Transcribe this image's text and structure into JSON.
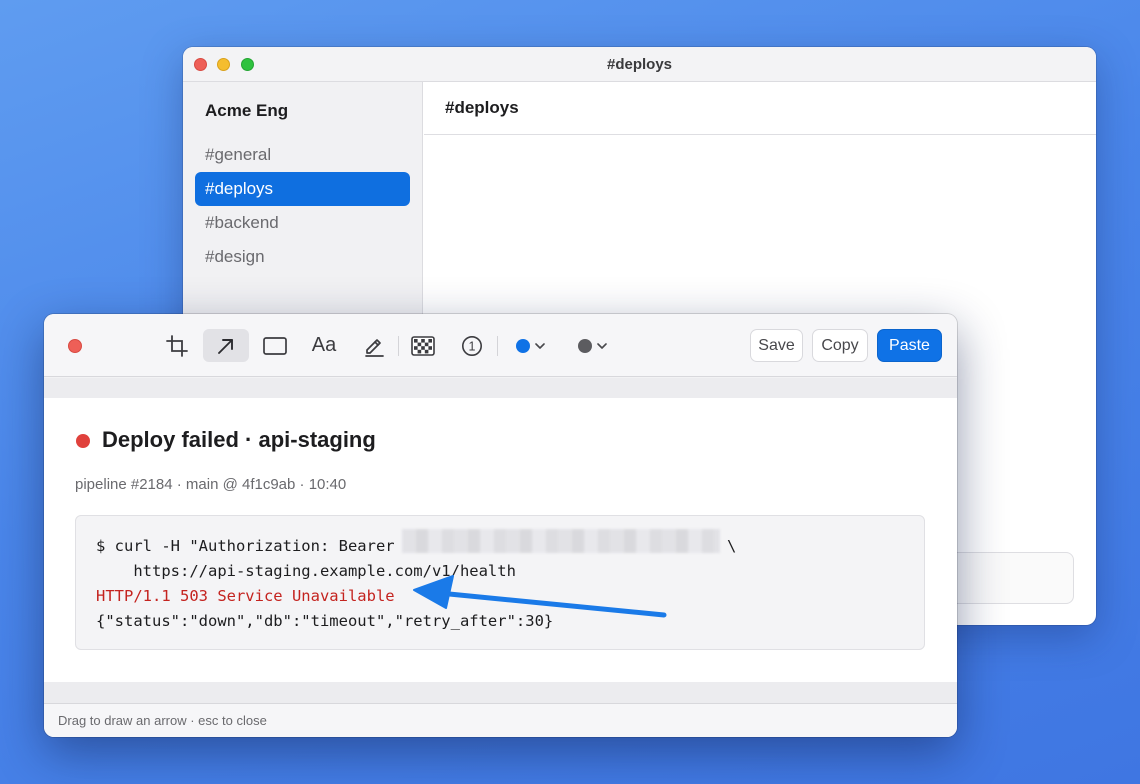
{
  "chat_window": {
    "title": "#deploys",
    "workspace": "Acme Eng",
    "channels": [
      {
        "label": "#general",
        "active": false
      },
      {
        "label": "#deploys",
        "active": true
      },
      {
        "label": "#backend",
        "active": false
      },
      {
        "label": "#design",
        "active": false
      }
    ],
    "main_title": "#deploys"
  },
  "markup_window": {
    "toolbar": {
      "tools": [
        {
          "name": "crop-icon"
        },
        {
          "name": "arrow-icon",
          "selected": true
        },
        {
          "name": "rectangle-icon"
        },
        {
          "name": "text-tool-icon",
          "label": "Aa"
        },
        {
          "name": "highlighter-icon"
        },
        {
          "name": "pixelate-icon"
        },
        {
          "name": "counter-icon",
          "label": "1"
        }
      ],
      "stroke_color": "#0f72e6",
      "fill_color": "#5c5c60",
      "save_label": "Save",
      "copy_label": "Copy",
      "paste_label": "Paste"
    },
    "content": {
      "title": "Deploy failed · api-staging",
      "meta": "pipeline #2184 · main @ 4f1c9ab · 10:40",
      "code": {
        "line1_prefix": "$ curl -H \"Authorization: Bearer",
        "line1_suffix": "\\",
        "line2": "    https://api-staging.example.com/v1/health",
        "line3": "HTTP/1.1 503 Service Unavailable",
        "line4": "{\"status\":\"down\",\"db\":\"timeout\",\"retry_after\":30}"
      },
      "annotation_color": "#1a7ae8"
    },
    "status_text": "Drag to draw an arrow · esc to close"
  },
  "colors": {
    "accent": "#0f72e6",
    "error_text": "#c4231f",
    "alert_dot": "#e0413c"
  }
}
